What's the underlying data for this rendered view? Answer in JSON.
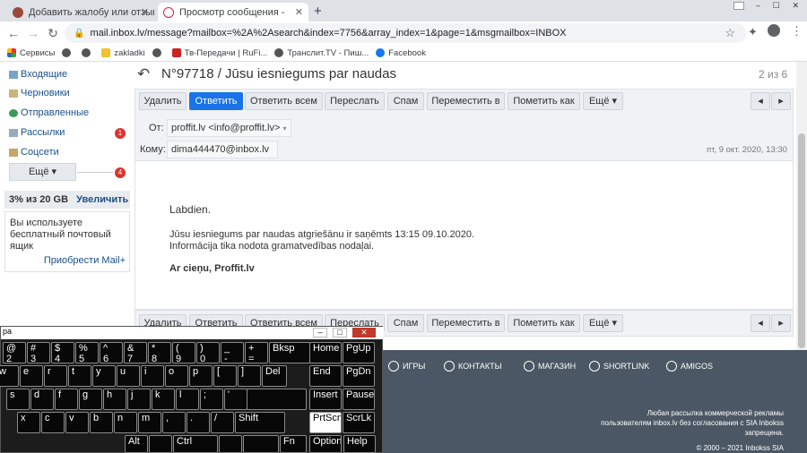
{
  "browser": {
    "tabs": [
      {
        "title": "Добавить жалобу или отзыв"
      },
      {
        "title": "Просмотр сообщения - Inbox.lv"
      }
    ],
    "new_tab": "+",
    "url": "mail.inbox.lv/message?mailbox=%2A%2Asearch&index=7756&array_index=1&page=1&msgmailbox=INBOX",
    "bookmarks": [
      "Сервисы",
      "zakladki",
      "Тв-Передачи | RuFi...",
      "Транслит.TV - Пиш...",
      "Facebook"
    ]
  },
  "sidebar": {
    "folders": [
      {
        "label": "Входящие"
      },
      {
        "label": "Черновики"
      },
      {
        "label": "Отправленные"
      },
      {
        "label": "Рассылки",
        "count": "1"
      },
      {
        "label": "Соцсети"
      }
    ],
    "more_label": "Ещё ▾",
    "more_count": "4",
    "storage": {
      "used": "3% из 20 GB",
      "upgrade": "Увеличить"
    },
    "promo": {
      "text": "Вы используете бесплатный почтовый ящик",
      "link": "Приобрести Mail+"
    }
  },
  "message": {
    "subject": "N°97718 / Jūsu iesniegums par naudas",
    "position": "2 из 6",
    "toolbar": {
      "delete": "Удалить",
      "reply": "Ответить",
      "reply_all": "Ответить всем",
      "forward": "Переслать",
      "spam": "Спам",
      "move": "Переместить в",
      "mark": "Пометить как",
      "more": "Ещё ▾"
    },
    "from_label": "От:",
    "from_value": "proffit.lv <info@proffit.lv>",
    "to_label": "Кому:",
    "to_value": "dima444470@inbox.lv",
    "date": "пт, 9 окт. 2020, 13:30",
    "body": {
      "greeting": "Labdien.",
      "line1": "Jūsu iesniegums par naudas atgriešānu ir saņēmts 13:15 09.10.2020.",
      "line2": "Informācija tika nodota gramatvedības nodaļai.",
      "signoff": "Ar cieņu, Proffit.lv"
    }
  },
  "footer": {
    "links": [
      "ИГРЫ",
      "КОНТАКТЫ",
      "МАГАЗИН",
      "SHORTLINK",
      "AMIGOS"
    ],
    "note1": "Любая рассылка коммерческой рекламы",
    "note2": "пользователям inbox.lv без согласования с SIA Inbokss",
    "note3": "запрещена.",
    "copyright": "© 2000 – 2021 Inbokss SIA"
  },
  "keyboard": {
    "title": "ра",
    "row1": [
      "2",
      "3",
      "4",
      "5",
      "6",
      "7",
      "8",
      "9",
      "0",
      "-",
      "=",
      "Bksp",
      "Home",
      "PgUp"
    ],
    "row1_top": [
      "@",
      "#",
      "$",
      "%",
      "^",
      "&",
      "*",
      "(",
      ")",
      "_",
      "+"
    ],
    "row2": [
      "w",
      "e",
      "r",
      "t",
      "y",
      "u",
      "i",
      "o",
      "p",
      "[",
      "]",
      "Del",
      "End",
      "PgDn"
    ],
    "row3": [
      "s",
      "d",
      "f",
      "g",
      "h",
      "j",
      "k",
      "l",
      ";",
      "'",
      "Insert",
      "Pause"
    ],
    "row4": [
      "x",
      "c",
      "v",
      "b",
      "n",
      "m",
      ",",
      ".",
      "/",
      "Shift",
      "PrtScn",
      "ScrLk"
    ],
    "row5": [
      "Alt",
      "Ctrl",
      "Fn",
      "Options",
      "Help"
    ]
  },
  "colors": {
    "accent": "#1a73e8",
    "link": "#1a4f8a",
    "footer": "#4b5764",
    "badge": "#e0322c",
    "storage_bg": "#e9ecef"
  }
}
